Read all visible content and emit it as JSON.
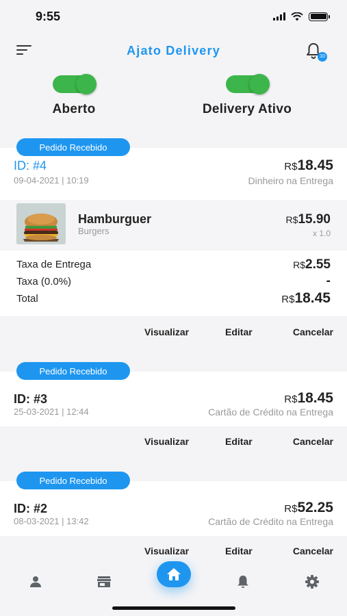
{
  "status_bar": {
    "time": "9:55"
  },
  "header": {
    "title": "Ajato Delivery",
    "notification_count": "10"
  },
  "toggles": [
    {
      "label": "Aberto",
      "on": true
    },
    {
      "label": "Delivery Ativo",
      "on": true
    }
  ],
  "colors": {
    "accent": "#1e96f0",
    "toggle_on": "#3cb54a"
  },
  "orders": [
    {
      "status": "Pedido Recebido",
      "id": "ID: #4",
      "date": "09-04-2021 | 10:19",
      "currency": "R$",
      "total": "18.45",
      "payment": "Dinheiro na Entrega",
      "item": {
        "name": "Hamburguer",
        "category": "Burgers",
        "currency": "R$",
        "price": "15.90",
        "qty": "x 1.0"
      },
      "fees": {
        "delivery_label": "Taxa de Entrega",
        "delivery_currency": "R$",
        "delivery_value": "2.55",
        "tax_label": "Taxa (0.0%)",
        "tax_value": "-",
        "total_label": "Total",
        "total_currency": "R$",
        "total_value": "18.45"
      }
    },
    {
      "status": "Pedido Recebido",
      "id": "ID: #3",
      "date": "25-03-2021 | 12:44",
      "currency": "R$",
      "total": "18.45",
      "payment": "Cartão de Crédito na Entrega"
    },
    {
      "status": "Pedido Recebido",
      "id": "ID: #2",
      "date": "08-03-2021 | 13:42",
      "currency": "R$",
      "total": "52.25",
      "payment": "Cartão de Crédito na Entrega"
    }
  ],
  "actions": {
    "view": "Visualizar",
    "edit": "Editar",
    "cancel": "Cancelar"
  },
  "tabbar": {
    "icons": [
      "user-icon",
      "store-icon",
      "home-icon",
      "bell-icon",
      "gear-icon"
    ],
    "active": "home-icon"
  }
}
